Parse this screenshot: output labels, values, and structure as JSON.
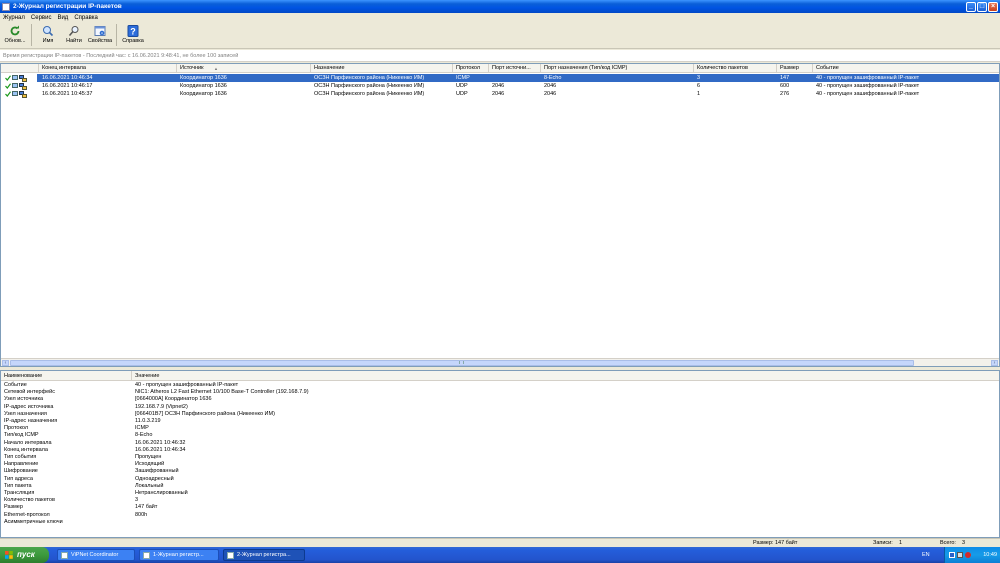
{
  "window": {
    "title": "2-Журнал регистрации IP-пакетов"
  },
  "menu": [
    "Журнал",
    "Сервис",
    "Вид",
    "Справка"
  ],
  "toolbar": {
    "refresh": "Обнов...",
    "name": "Имя",
    "find": "Найти",
    "properties": "Свойства",
    "help": "Справка"
  },
  "infoline": "Время регистрации IP-пакетов - Последний час: с 16.06.2021 9:48:41, не более 100 записей",
  "list": {
    "columns": {
      "end": "Конец интервала",
      "source": "Источник",
      "dest": "Назначение",
      "proto": "Протокол",
      "srcport": "Порт источни...",
      "dstport": "Порт назначения (Тип/код ICMP)",
      "count": "Количество пакетов",
      "size": "Размер",
      "event": "Событие"
    },
    "sort_indicator": "▲",
    "rows": [
      {
        "end": "16.06.2021 10:46:34",
        "source": "Координатор 1636",
        "dest": "ОСЗН Парфинского района (Никеенко ИМ)",
        "proto": "ICMP",
        "srcport": "",
        "dstport": "8-Echo",
        "count": "3",
        "size": "147",
        "event": "40 - пропущен зашифрованный IP-пакет"
      },
      {
        "end": "16.06.2021 10:46:17",
        "source": "Координатор 1636",
        "dest": "ОСЗН Парфинского района (Никеенко ИМ)",
        "proto": "UDP",
        "srcport": "2046",
        "dstport": "2046",
        "count": "6",
        "size": "600",
        "event": "40 - пропущен зашифрованный IP-пакет"
      },
      {
        "end": "16.06.2021 10:45:37",
        "source": "Координатор 1636",
        "dest": "ОСЗН Парфинского района (Никеенко ИМ)",
        "proto": "UDP",
        "srcport": "2046",
        "dstport": "2046",
        "count": "1",
        "size": "276",
        "event": "40 - пропущен зашифрованный IP-пакет"
      }
    ]
  },
  "details": {
    "col_name": "Наименование",
    "col_value": "Значение",
    "rows": [
      {
        "k": "Событие",
        "v": "40 - пропущен зашифрованный IP-пакет"
      },
      {
        "k": "Сетевой интерфейс",
        "v": "NIC1: Atheros L2 Fast Ethernet 10/100 Base-T Controller (192.168.7.9)"
      },
      {
        "k": "Узел источника",
        "v": "[0664000A] Координатор 1636"
      },
      {
        "k": "IP-адрес источника",
        "v": "192.168.7.9 (Vipnet2)"
      },
      {
        "k": "Узел назначения",
        "v": "[066401B7] ОСЗН Парфинского района (Никеенко ИМ)"
      },
      {
        "k": "IP-адрес назначения",
        "v": "11.0.3.219"
      },
      {
        "k": "Протокол",
        "v": "ICMP"
      },
      {
        "k": "Тип/код ICMP",
        "v": "8-Echo"
      },
      {
        "k": "Начало интервала",
        "v": "16.06.2021 10:46:32"
      },
      {
        "k": "Конец интервала",
        "v": "16.06.2021 10:46:34"
      },
      {
        "k": "Тип события",
        "v": "Пропущен"
      },
      {
        "k": "Направление",
        "v": "Исходящий"
      },
      {
        "k": "Шифрование",
        "v": "Зашифрованный"
      },
      {
        "k": "Тип адреса",
        "v": "Одноадресный"
      },
      {
        "k": "Тип пакета",
        "v": "Локальный"
      },
      {
        "k": "Трансляция",
        "v": "Нетранслированный"
      },
      {
        "k": "Количество пакетов",
        "v": "3"
      },
      {
        "k": "Размер",
        "v": "147 байт"
      },
      {
        "k": "Ethernet-протокол",
        "v": "800h"
      },
      {
        "k": "Асимметричные ключи",
        "v": ""
      }
    ]
  },
  "status": {
    "size": "Размер: 147 байт",
    "records_label": "Записи:",
    "records_value": "1",
    "total_label": "Всего:",
    "total_value": "3"
  },
  "taskbar": {
    "start": "пуск",
    "tasks": [
      "ViPNet Coordinator",
      "1-Журнал регистр...",
      "2-Журнал регистра..."
    ],
    "lang": "EN",
    "clock": "10:49"
  },
  "colors": {
    "selection": "#316ac5",
    "titlebar": "#0054e3",
    "taskbar": "#245edb"
  }
}
